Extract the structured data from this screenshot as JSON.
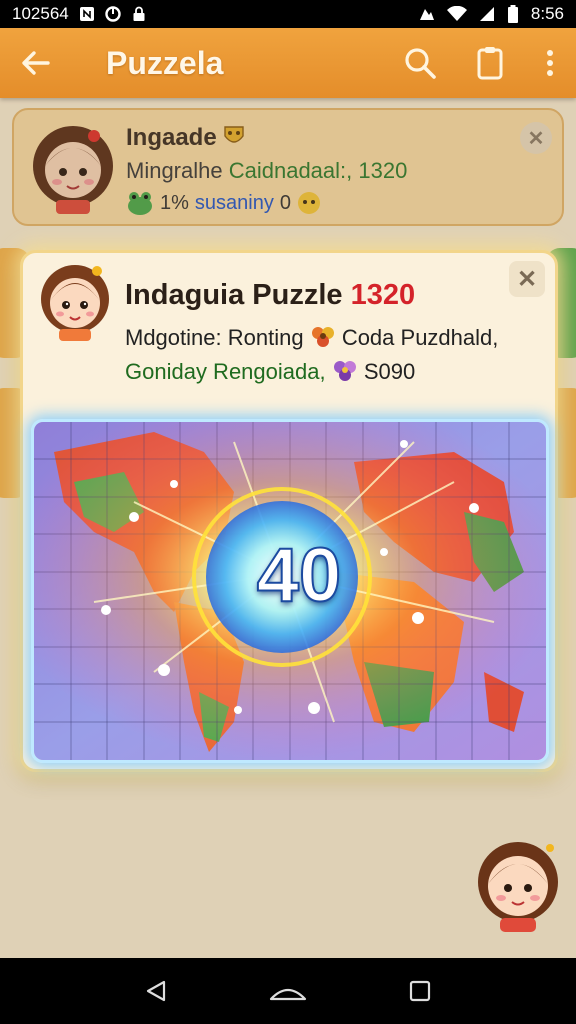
{
  "status_bar": {
    "left_text": "102564",
    "time": "8:56",
    "icons": [
      "nfc-icon",
      "sync-icon",
      "lock-icon",
      "gallery-icon",
      "wifi-icon",
      "signal-icon",
      "battery-icon"
    ]
  },
  "app_bar": {
    "title": "Puzzela",
    "icons": [
      "back-arrow-icon",
      "search-icon",
      "clipboard-icon",
      "more-vert-icon"
    ]
  },
  "background_card": {
    "title": "Ingaade",
    "subtitle_prefix": "Mingralhe",
    "subtitle_green": "Caidnadaal:, 1320",
    "meta_count": "1%",
    "meta_link": "susaniny",
    "meta_suffix": "0"
  },
  "dialog": {
    "title": "Indaguia Puzzle",
    "title_number": "1320",
    "line1": "Mdgotine: Ronting",
    "line1_suffix": "Coda Puzdhald,",
    "line2": "Goniday Rengoiada,",
    "line2_suffix": "S090",
    "score": "40",
    "colors": {
      "accent": "#d4232a",
      "green_text": "#1f6b1f",
      "score_outline": "#1b4aa0",
      "glow": "#ffd43b"
    }
  },
  "nav_bar": {
    "icons": [
      "nav-back-icon",
      "nav-home-icon",
      "nav-recents-icon"
    ]
  }
}
